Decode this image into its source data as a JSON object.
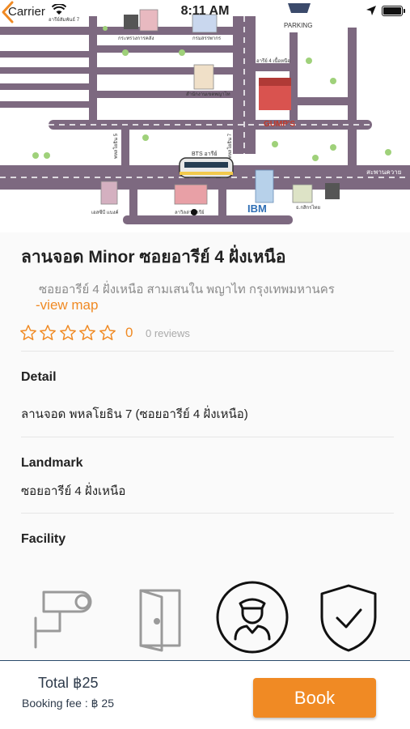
{
  "status_bar": {
    "carrier": "Carrier",
    "time": "8:11 AM",
    "wifi_icon": "wifi-icon",
    "location_icon": "location-arrow-icon",
    "battery_icon": "battery-icon"
  },
  "map": {
    "labels": {
      "parking": "PARKING",
      "ibm": "IBM",
      "bts": "BTS อารีย์",
      "road_right": "สะพานควาย",
      "soi_top": "อารีย์สัมพันธ์ 7",
      "gov1": "กระทรวงการคลัง",
      "gov2": "กรมสรรพากร",
      "office": "สำนักงานเขตพญาไท",
      "soi4": "อารีย์ 4 เนื้อหนือ",
      "soi5": "พหลโยธิน 5",
      "soi7": "พหลโยธิน 7",
      "ais": "เอสซีบี แบงค์",
      "thai": "ธ.กสิกรไทย",
      "la": "ลาวิลล่า อารีย์",
      "gump": "GUMP'S"
    },
    "back_icon": "chevron-left-icon"
  },
  "place": {
    "title": "ลานจอด Minor ซอยอารีย์ 4 ฝั่งเหนือ",
    "address": "ซอยอารีย์ 4 ฝั่งเหนือ สามเสนใน พญาไท กรุงเทพมหานคร",
    "view_map": "-view map",
    "rating": "0",
    "star_count": 5,
    "reviews": "0 reviews"
  },
  "detail": {
    "label": "Detail",
    "value": "ลานจอด พหลโยธิน 7 (ซอยอารีย์ 4 ฝั่งเหนือ)"
  },
  "landmark": {
    "label": "Landmark",
    "value": "ซอยอารีย์ 4 ฝั่งเหนือ"
  },
  "facility": {
    "label": "Facility",
    "items": [
      {
        "icon": "cctv-camera-icon",
        "active": false
      },
      {
        "icon": "door-icon",
        "active": false
      },
      {
        "icon": "security-guard-icon",
        "active": true
      },
      {
        "icon": "shield-check-icon",
        "active": true
      }
    ]
  },
  "footer": {
    "total": "Total ฿25",
    "booking_fee": "Booking fee : ฿ 25",
    "book_label": "Book"
  },
  "colors": {
    "accent": "#f08a24",
    "road": "#7d6980",
    "text_dark": "#222222",
    "footer_text": "#2d3a4a"
  }
}
